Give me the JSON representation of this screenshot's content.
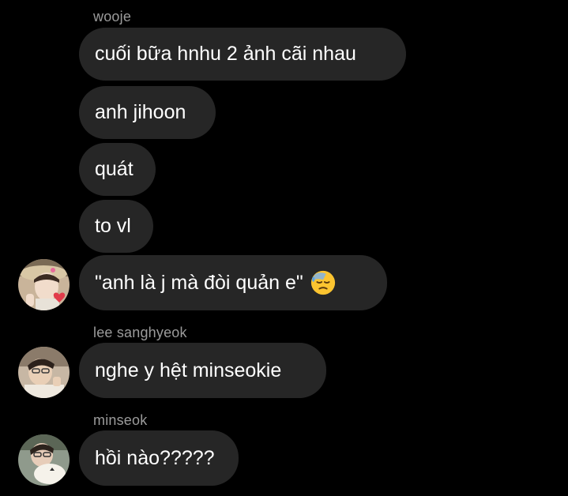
{
  "messages": [
    {
      "sender": "wooje",
      "text": "cuối bữa hnhu 2 ảnh cãi nhau"
    },
    {
      "text": "anh jihoon"
    },
    {
      "text": "quát"
    },
    {
      "text": "to vl"
    },
    {
      "text": "\"anh là j mà đòi quản e\"",
      "emoji": "downcast-face-with-sweat"
    },
    {
      "sender": "lee sanghyeok",
      "text": "nghe y hệt minseokie"
    },
    {
      "sender": "minseok",
      "text": "hồi nào?????"
    }
  ],
  "colors": {
    "background": "#000000",
    "bubble": "#262626",
    "sender_label": "#9b9b9b",
    "message_text": "#ffffff"
  }
}
